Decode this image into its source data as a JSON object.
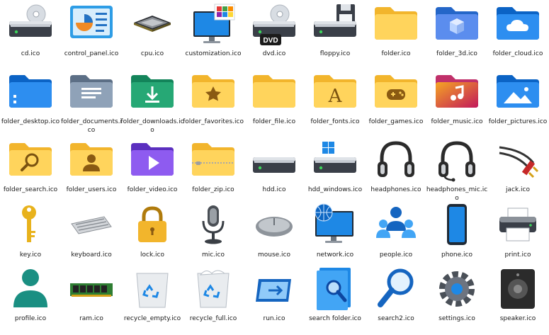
{
  "files": [
    {
      "label": "cd.ico",
      "icon": "cd-drive-icon"
    },
    {
      "label": "control_panel.ico",
      "icon": "control-panel-icon"
    },
    {
      "label": "cpu.ico",
      "icon": "cpu-icon"
    },
    {
      "label": "customization.ico",
      "icon": "customization-icon"
    },
    {
      "label": "dvd.ico",
      "icon": "dvd-drive-icon"
    },
    {
      "label": "floppy.ico",
      "icon": "floppy-drive-icon"
    },
    {
      "label": "folder.ico",
      "icon": "folder-icon"
    },
    {
      "label": "folder_3d.ico",
      "icon": "folder-3d-icon"
    },
    {
      "label": "folder_cloud.ico",
      "icon": "folder-cloud-icon"
    },
    {
      "label": "folder_desktop.ico",
      "icon": "folder-desktop-icon"
    },
    {
      "label": "folder_documents.ico",
      "icon": "folder-documents-icon"
    },
    {
      "label": "folder_downloads.ico",
      "icon": "folder-downloads-icon"
    },
    {
      "label": "folder_favorites.ico",
      "icon": "folder-favorites-icon"
    },
    {
      "label": "folder_file.ico",
      "icon": "folder-file-icon"
    },
    {
      "label": "folder_fonts.ico",
      "icon": "folder-fonts-icon"
    },
    {
      "label": "folder_games.ico",
      "icon": "folder-games-icon"
    },
    {
      "label": "folder_music.ico",
      "icon": "folder-music-icon"
    },
    {
      "label": "folder_pictures.ico",
      "icon": "folder-pictures-icon"
    },
    {
      "label": "folder_search.ico",
      "icon": "folder-search-icon"
    },
    {
      "label": "folder_users.ico",
      "icon": "folder-users-icon"
    },
    {
      "label": "folder_video.ico",
      "icon": "folder-video-icon"
    },
    {
      "label": "folder_zip.ico",
      "icon": "folder-zip-icon"
    },
    {
      "label": "hdd.ico",
      "icon": "hdd-icon"
    },
    {
      "label": "hdd_windows.ico",
      "icon": "hdd-windows-icon"
    },
    {
      "label": "headphones.ico",
      "icon": "headphones-icon"
    },
    {
      "label": "headphones_mic.ico",
      "icon": "headphones-mic-icon"
    },
    {
      "label": "jack.ico",
      "icon": "audio-jack-icon"
    },
    {
      "label": "key.ico",
      "icon": "key-icon"
    },
    {
      "label": "keyboard.ico",
      "icon": "keyboard-icon"
    },
    {
      "label": "lock.ico",
      "icon": "lock-icon"
    },
    {
      "label": "mic.ico",
      "icon": "microphone-icon"
    },
    {
      "label": "mouse.ico",
      "icon": "mouse-icon"
    },
    {
      "label": "network.ico",
      "icon": "network-icon"
    },
    {
      "label": "people.ico",
      "icon": "people-icon"
    },
    {
      "label": "phone.ico",
      "icon": "phone-icon"
    },
    {
      "label": "print.ico",
      "icon": "printer-icon"
    },
    {
      "label": "profile.ico",
      "icon": "profile-icon"
    },
    {
      "label": "ram.ico",
      "icon": "ram-icon"
    },
    {
      "label": "recycle_empty.ico",
      "icon": "recycle-bin-empty-icon"
    },
    {
      "label": "recycle_full.ico",
      "icon": "recycle-bin-full-icon"
    },
    {
      "label": "run.ico",
      "icon": "run-icon"
    },
    {
      "label": "search folder.ico",
      "icon": "search-folder-icon"
    },
    {
      "label": "search2.ico",
      "icon": "search-icon"
    },
    {
      "label": "settings.ico",
      "icon": "settings-gear-icon"
    },
    {
      "label": "speaker.ico",
      "icon": "speaker-icon"
    }
  ],
  "dvd_badge": "DVD",
  "font_glyph": "A"
}
